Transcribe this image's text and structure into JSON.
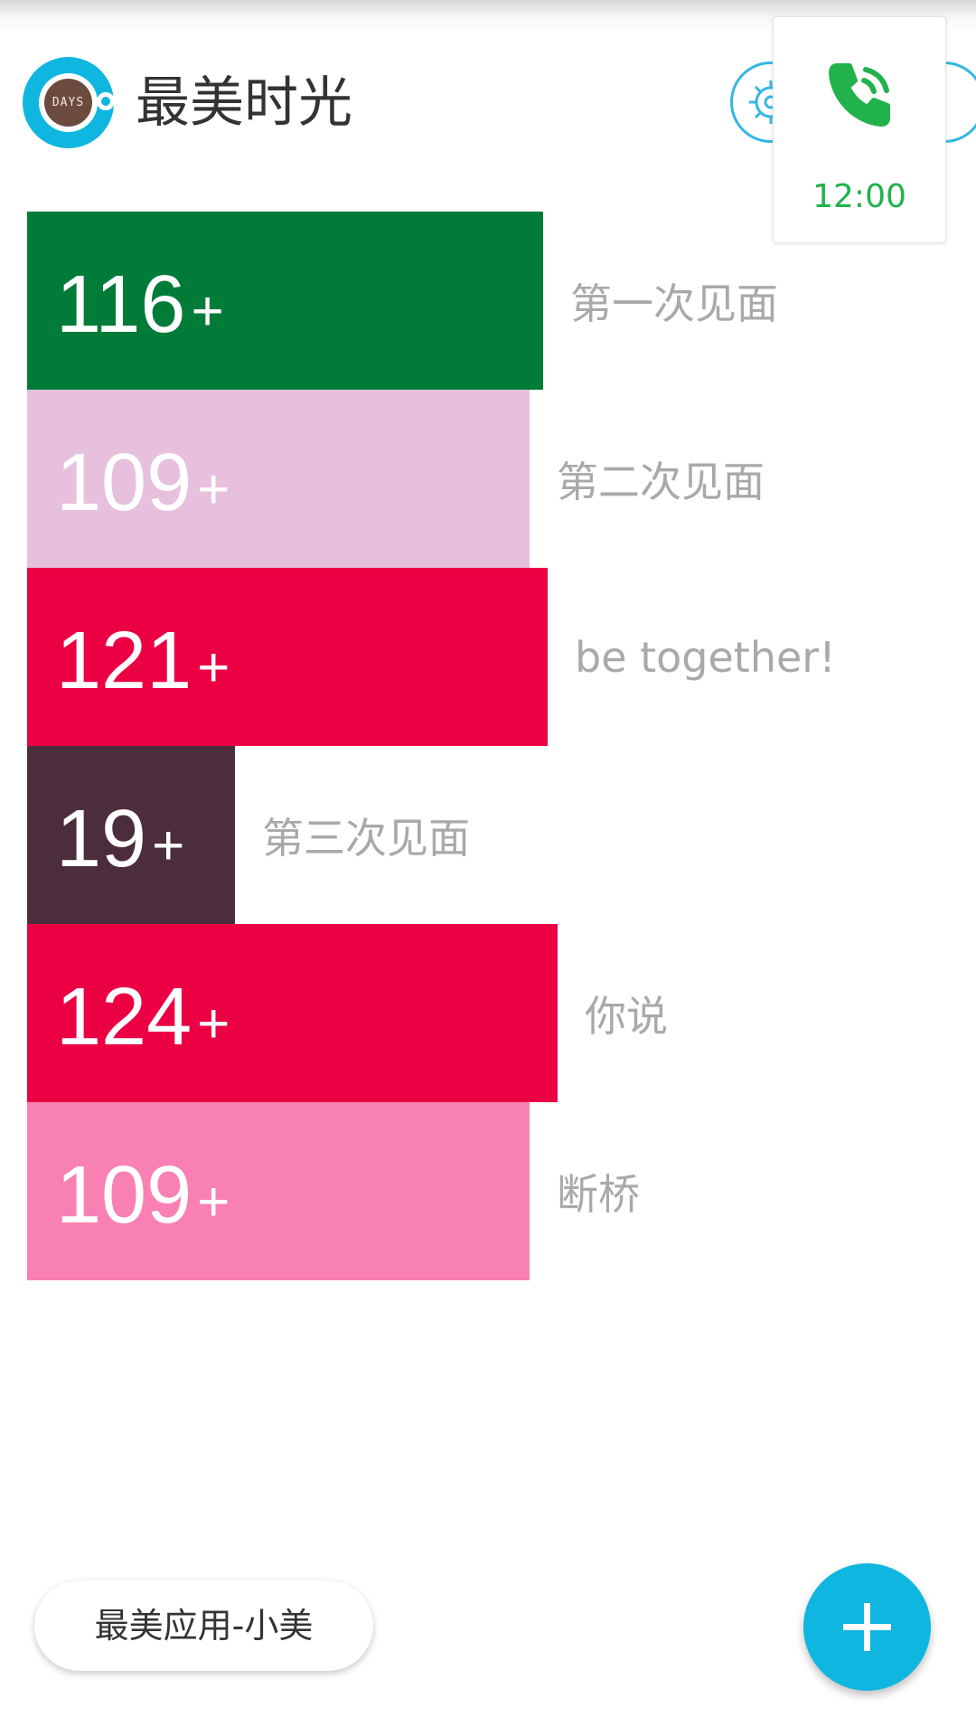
{
  "header": {
    "app_title": "最美时光",
    "logo_text": "DAYS"
  },
  "call_widget": {
    "time": "12:00"
  },
  "events": [
    {
      "count": "116",
      "suffix": "+",
      "label": "第一次见面",
      "color": "#007b38",
      "bar_fraction": 0.56
    },
    {
      "count": "109",
      "suffix": "+",
      "label": "第二次见面",
      "color": "#e6c0dd",
      "bar_fraction": 0.545
    },
    {
      "count": "121",
      "suffix": "+",
      "label": "be together!",
      "color": "#ec0044",
      "bar_fraction": 0.565
    },
    {
      "count": "19",
      "suffix": "+",
      "label": "第三次见面",
      "color": "#4b2d3e",
      "bar_fraction": 0.225
    },
    {
      "count": "124",
      "suffix": "+",
      "label": "你说",
      "color": "#ec0044",
      "bar_fraction": 0.575
    },
    {
      "count": "109",
      "suffix": "+",
      "label": "断桥",
      "color": "#f880b3",
      "bar_fraction": 0.545
    }
  ],
  "promo": {
    "label": "最美应用-小美"
  },
  "colors": {
    "accent": "#0fb6e0",
    "call_green": "#22b24c"
  },
  "icons": {
    "logo": "coffee-cup-icon",
    "settings": "gear-icon",
    "call": "phone-call-icon",
    "add": "plus-icon"
  }
}
